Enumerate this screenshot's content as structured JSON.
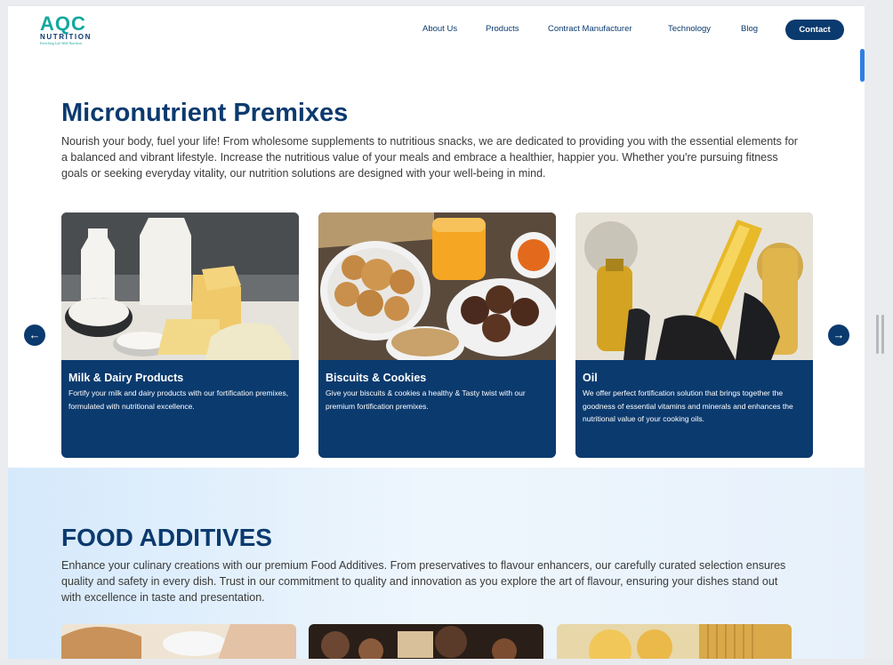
{
  "header": {
    "logo_mark": "AQC",
    "logo_word": "NUTRITION",
    "logo_tag": "Enriching Life With Nutrition",
    "nav": [
      "About Us",
      "Products",
      "Contract Manufacturer",
      "Technology",
      "Blog"
    ],
    "contact_label": "Contact"
  },
  "micro": {
    "title": "Micronutrient Premixes",
    "text": "Nourish your body, fuel your life! From wholesome supplements to nutritious snacks, we are dedicated to providing you with the essential elements for a balanced and vibrant lifestyle. Increase the nutritious value of your meals and embrace a healthier, happier you. Whether you're pursuing fitness goals or seeking everyday vitality, our nutrition solutions are designed with your well-being in mind.",
    "cards": [
      {
        "title": "Milk & Dairy Products",
        "desc": "Fortify your milk and dairy products with our fortification premixes, formulated with nutritional excellence."
      },
      {
        "title": "Biscuits & Cookies",
        "desc": "Give your biscuits & cookies a healthy & Tasty twist with our premium fortification premixes."
      },
      {
        "title": "Oil",
        "desc": "We offer perfect fortification solution that brings together the goodness of essential vitamins and minerals and enhances the nutritional value of your cooking oils."
      }
    ],
    "prev": "←",
    "next": "→"
  },
  "food": {
    "title": "FOOD ADDITIVES",
    "text": "Enhance your culinary creations with our premium Food Additives. From preservatives to flavour enhancers, our carefully curated selection ensures quality and safety in every dish. Trust in our commitment to quality and innovation as you explore the art of flavour, ensuring your dishes stand out with excellence in taste and presentation."
  },
  "colors": {
    "brand_navy": "#0b3a6e",
    "brand_teal": "#13a89e"
  },
  "icons": [
    "arrow-left-icon",
    "arrow-right-icon"
  ]
}
